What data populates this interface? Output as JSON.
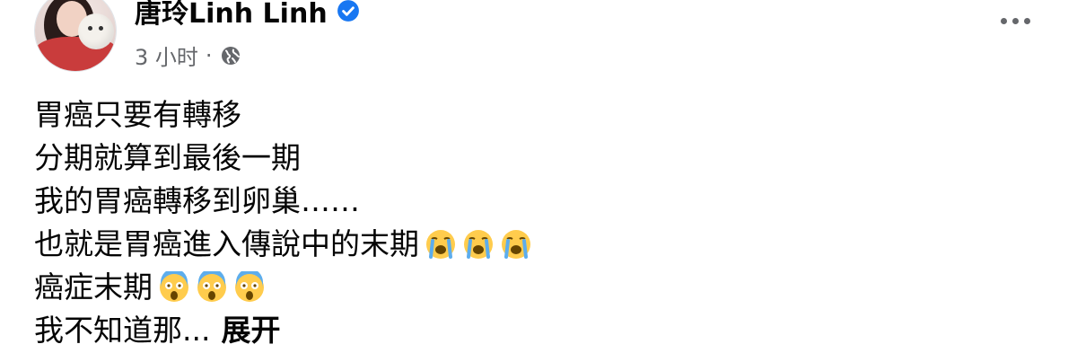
{
  "post": {
    "author_name": "唐玲Linh Linh",
    "timestamp": "3 小时",
    "separator": "·",
    "more_options_icon": "ellipsis-icon",
    "verified_icon": "verified-badge-icon",
    "audience_icon": "globe-icon",
    "lines": [
      {
        "text": "胃癌只要有轉移"
      },
      {
        "text": "分期就算到最後一期"
      },
      {
        "text": "我的胃癌轉移到卵巢……"
      },
      {
        "text": "也就是胃癌進入傳說中的末期"
      },
      {
        "text": "癌症末期"
      },
      {
        "text": "我不知道那..."
      }
    ],
    "see_more": "展开",
    "emoji_crying": "loudly-crying-face",
    "emoji_screaming": "face-screaming-in-fear",
    "colors": {
      "verified_blue": "#1877F2",
      "meta_gray": "#65676B",
      "text": "#050505"
    }
  }
}
